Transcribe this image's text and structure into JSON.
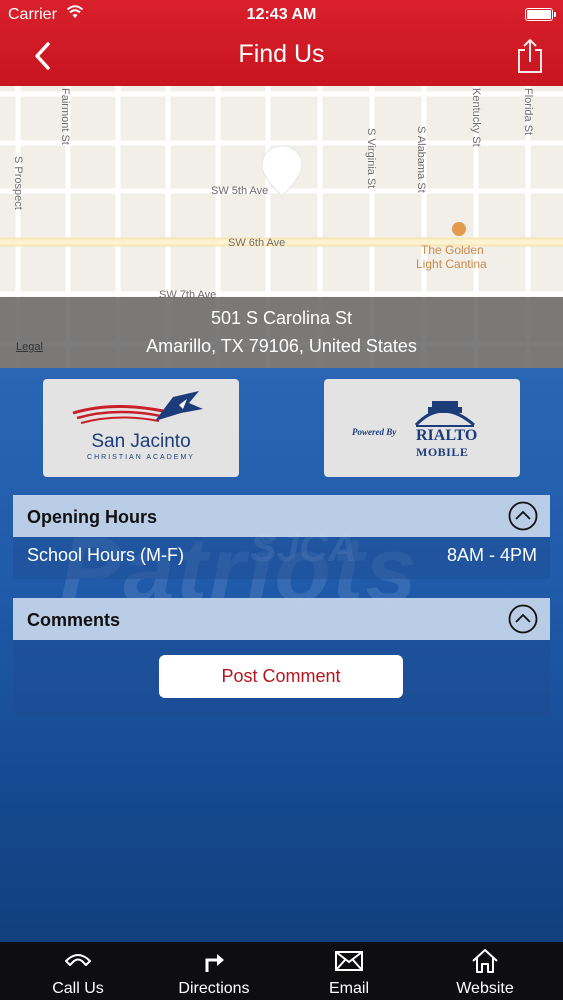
{
  "status_bar": {
    "carrier": "Carrier",
    "time": "12:43 AM"
  },
  "nav": {
    "title": "Find Us",
    "back_icon": "chevron-left-icon",
    "share_icon": "share-icon"
  },
  "map": {
    "streets": [
      "S Prospect",
      "Fairmont St",
      "SW 5th Ave",
      "S Virginia St",
      "S Alabama St",
      "Kentucky St",
      "Florida St",
      "SW 6th Ave",
      "SW 7th Ave"
    ],
    "poi": [
      "The Golden",
      "Light Cantina"
    ],
    "legal": "Legal"
  },
  "address": {
    "line1": "501 S Carolina St",
    "line2": "Amarillo, TX 79106, United States"
  },
  "logos": {
    "left": {
      "name": "San Jacinto",
      "subtitle": "CHRISTIAN ACADEMY"
    },
    "right": {
      "powered_by": "Powered By",
      "brand": "RIALTO",
      "brand_sub": "MOBILE"
    }
  },
  "background_text": {
    "small": "SJCA",
    "large": "Patriots"
  },
  "opening_hours": {
    "title": "Opening Hours",
    "rows": [
      {
        "label": "School Hours (M-F)",
        "time": "8AM - 4PM"
      }
    ]
  },
  "comments": {
    "title": "Comments",
    "post_label": "Post Comment"
  },
  "tabs": [
    {
      "label": "Call Us",
      "icon": "phone-icon"
    },
    {
      "label": "Directions",
      "icon": "directions-icon"
    },
    {
      "label": "Email",
      "icon": "envelope-icon"
    },
    {
      "label": "Website",
      "icon": "home-icon"
    }
  ],
  "colors": {
    "header_red": "#d9202c",
    "content_blue": "#1f5aa8",
    "button_text_red": "#b8141e",
    "tabbar": "#0e0e10"
  }
}
